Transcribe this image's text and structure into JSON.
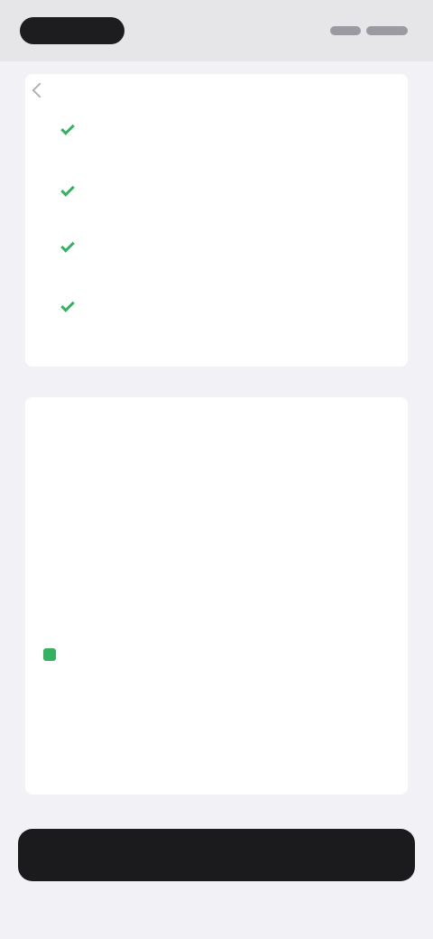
{
  "benefits": [
    {
      "title": "",
      "description": ""
    },
    {
      "title": "",
      "description": ""
    },
    {
      "title": "",
      "description": ""
    },
    {
      "title": "",
      "description": ""
    }
  ],
  "summary": {
    "title": "",
    "subtitle": "",
    "rows": [
      {
        "label": "",
        "value": ""
      },
      {
        "label": "",
        "value": ""
      },
      {
        "label": "",
        "value": ""
      },
      {
        "label": "",
        "value": ""
      },
      {
        "label": "",
        "value": ""
      }
    ],
    "total": {
      "label": "",
      "value": ""
    }
  },
  "cta": {
    "label": ""
  },
  "colors": {
    "accent_green": "#34b260",
    "button_dark": "#1b1b1e",
    "page_bg": "#f2f2f6"
  },
  "icons": [
    "back-arrow-icon",
    "check-icon",
    "tag-icon"
  ]
}
